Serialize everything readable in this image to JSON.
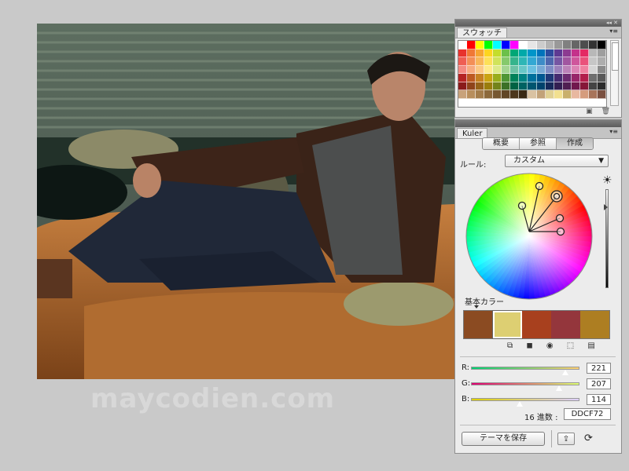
{
  "watermark": "maycodien.com",
  "swatches_panel": {
    "tab": "スウォッチ",
    "menu_icon": "panel-menu-icon",
    "colors": [
      "#ffffff",
      "#ff0000",
      "#ffff00",
      "#00ff00",
      "#00ffff",
      "#0000ff",
      "#ff00ff",
      "#ffffff",
      "#e6e6e6",
      "#cccccc",
      "#b3b3b3",
      "#999999",
      "#808080",
      "#666666",
      "#4d4d4d",
      "#333333",
      "#000000",
      "#e8322d",
      "#f07836",
      "#f6a531",
      "#fdd51f",
      "#c4dd2c",
      "#6cc04a",
      "#00a776",
      "#00a9a9",
      "#0095c9",
      "#0073bb",
      "#2d4b9e",
      "#5e3a93",
      "#8c3b91",
      "#c4318b",
      "#e42a63",
      "#b8b8b8",
      "#9e9e9e",
      "#ef5e54",
      "#f38f58",
      "#f8b659",
      "#fde058",
      "#d0e35a",
      "#86c96c",
      "#36b48c",
      "#2eb6b6",
      "#33a8d3",
      "#3e8cc7",
      "#4e67ae",
      "#7656a3",
      "#a156a0",
      "#cf569c",
      "#ea527b",
      "#c6c6c6",
      "#adadad",
      "#f48b83",
      "#f7ab80",
      "#fbc985",
      "#feea8a",
      "#dcea88",
      "#a4d591",
      "#6dc3a6",
      "#68c7c7",
      "#6ac0e0",
      "#77a9d5",
      "#7e8cc4",
      "#9a80bb",
      "#bb82b8",
      "#dc82b4",
      "#f081a0",
      "#d4d4d4",
      "#8a8a8a",
      "#b52424",
      "#bd5a22",
      "#c68121",
      "#caa412",
      "#98ad1c",
      "#4f9635",
      "#00825a",
      "#008282",
      "#00709c",
      "#005891",
      "#1f3978",
      "#452b70",
      "#6b2b6f",
      "#982569",
      "#b31e4b",
      "#6e6e6e",
      "#595959",
      "#8a1a1a",
      "#8f431a",
      "#966218",
      "#9a7d0c",
      "#73831a",
      "#3b7126",
      "#006244",
      "#006262",
      "#00556f",
      "#00426c",
      "#16295a",
      "#331f52",
      "#501f52",
      "#71184d",
      "#861638",
      "#444444",
      "#2b2b2b",
      "#c8a27a",
      "#b88e5c",
      "#a37c4a",
      "#8c693b",
      "#765730",
      "#614625",
      "#4c361b",
      "#3a2914",
      "#d9c2a2",
      "#c2a279",
      "#e0d093",
      "#f2e08f",
      "#c9b06c",
      "#e8b8a0",
      "#d59c7d",
      "#a8745a",
      "#7a5040"
    ],
    "tools": [
      "new-swatch-icon",
      "delete-swatch-icon"
    ]
  },
  "kuler_panel": {
    "tab": "Kuler",
    "segments": [
      "概要",
      "参照",
      "作成"
    ],
    "rule_label": "ルール:",
    "rule_value": "カスタム",
    "base_color_label": "基本カラー",
    "theme_colors": [
      "#8b4b22",
      "#ddcf72",
      "#a8401e",
      "#94363c",
      "#ad7e22"
    ],
    "selected_index": 1,
    "channels": [
      {
        "label": "R:",
        "value": "221",
        "fraction": 0.867,
        "gradient": "linear-gradient(90deg,#00cf72,#ffcf72)"
      },
      {
        "label": "G:",
        "value": "207",
        "fraction": 0.812,
        "gradient": "linear-gradient(90deg,#dd0072,#ddff72)"
      },
      {
        "label": "B:",
        "value": "114",
        "fraction": 0.447,
        "gradient": "linear-gradient(90deg,#ddcf00,#ddcfff)"
      }
    ],
    "hex_label": "16 進数 :",
    "hex_value": "DDCF72",
    "save_label": "テーマを保存",
    "upload_icon": "upload-theme-icon",
    "sync_icon": "sync-icon"
  }
}
